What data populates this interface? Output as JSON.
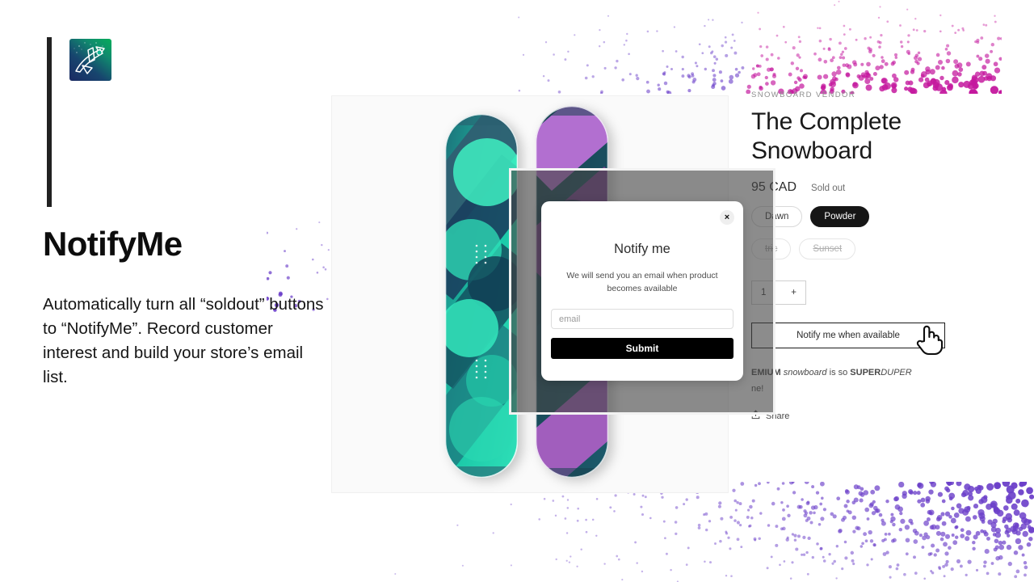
{
  "hero": {
    "logo_icon": "rocket-logo-icon",
    "title": "NotifyMe",
    "body": "Automatically turn all “soldout” buttons to “NotifyMe”. Record customer interest and build your store’s email list."
  },
  "product": {
    "vendor": "SNOWBOARD VENDOR",
    "title": "The Complete Snowboard",
    "price": "95 CAD",
    "availability": "Sold out",
    "variants_row1": [
      {
        "label": "Dawn",
        "state": "available"
      },
      {
        "label": "Powder",
        "state": "selected"
      }
    ],
    "variants_row2": [
      {
        "label": "tric",
        "state": "unavailable"
      },
      {
        "label": "Sunset",
        "state": "unavailable"
      }
    ],
    "quantity": "1",
    "quantity_increment": "+",
    "notify_button": "Notify me when available",
    "description_plain": "EMIUM snowboard is so SUPERDUPER ne!",
    "description_parts": {
      "a": "EMIUM ",
      "b": "snowboard",
      "c": " is so ",
      "d": "SUPER",
      "e": "DUPER",
      "f": "ne!"
    },
    "share_label": "Share",
    "share_icon": "share-icon"
  },
  "modal": {
    "title": "Notify me",
    "subtitle": "We will send you an email when product becomes available",
    "email_placeholder": "email",
    "email_value": "",
    "submit_label": "Submit",
    "close_icon": "close-icon",
    "close_glyph": "×"
  },
  "cursor": {
    "icon": "pointer-hand-cursor"
  },
  "colors": {
    "accent_bar": "#212121",
    "dots_purple": "#6b3fc9",
    "dots_magenta": "#c4189e",
    "button_black": "#000000",
    "board_teal": "#2fe0b8",
    "board_purple": "#a95fc2"
  }
}
